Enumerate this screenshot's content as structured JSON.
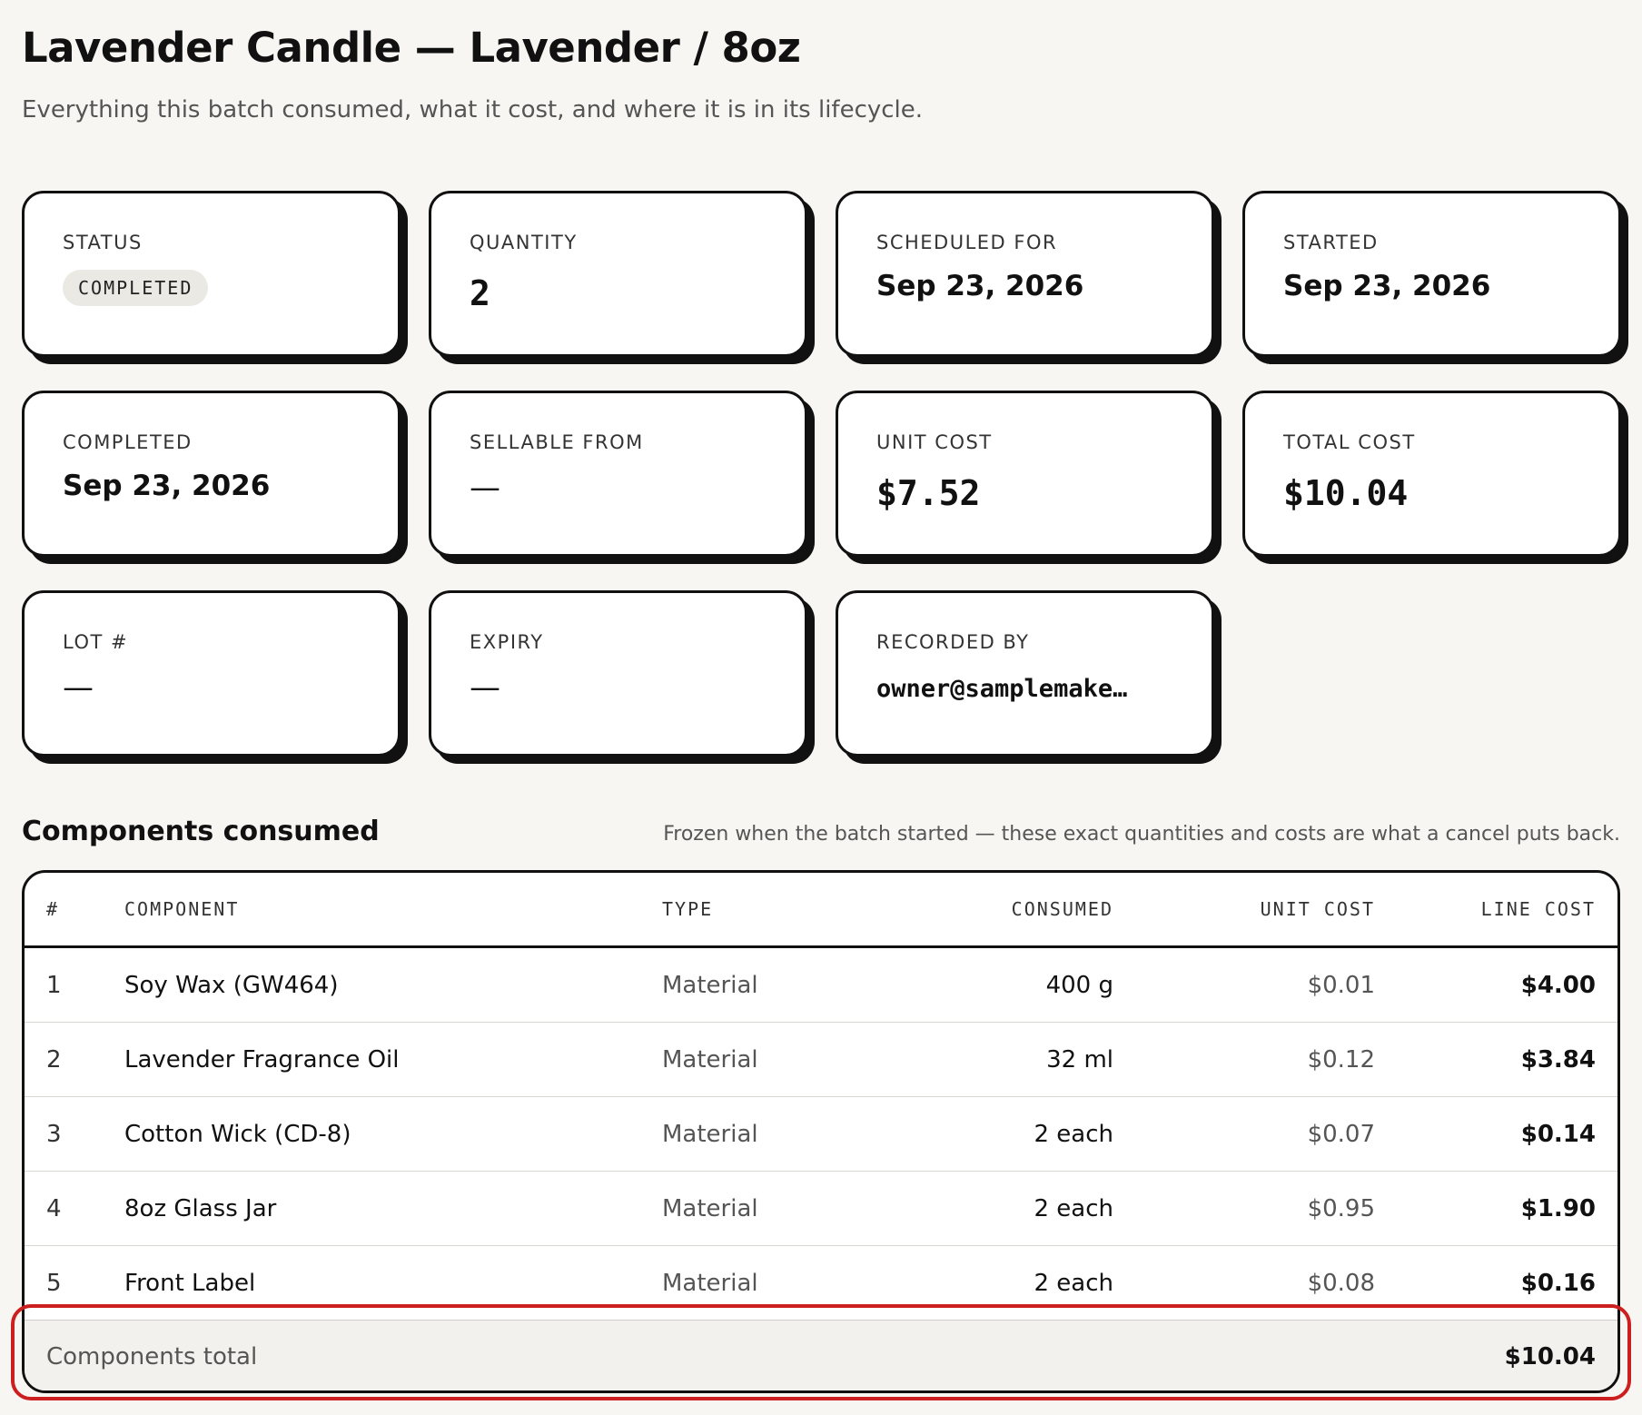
{
  "header": {
    "title": "Lavender Candle — Lavender / 8oz",
    "subtitle": "Everything this batch consumed, what it cost, and where it is in its lifecycle."
  },
  "stats": {
    "status": {
      "label": "STATUS",
      "value": "COMPLETED"
    },
    "quantity": {
      "label": "QUANTITY",
      "value": "2"
    },
    "scheduled_for": {
      "label": "SCHEDULED FOR",
      "value": "Sep 23, 2026"
    },
    "started": {
      "label": "STARTED",
      "value": "Sep 23, 2026"
    },
    "completed": {
      "label": "COMPLETED",
      "value": "Sep 23, 2026"
    },
    "sellable_from": {
      "label": "SELLABLE FROM",
      "value": "—"
    },
    "unit_cost": {
      "label": "UNIT COST",
      "value": "$7.52"
    },
    "total_cost": {
      "label": "TOTAL COST",
      "value": "$10.04"
    },
    "lot": {
      "label": "LOT #",
      "value": "—"
    },
    "expiry": {
      "label": "EXPIRY",
      "value": "—"
    },
    "recorded_by": {
      "label": "RECORDED BY",
      "value": "owner@samplemake…"
    }
  },
  "components": {
    "title": "Components consumed",
    "note": "Frozen when the batch started — these exact quantities and costs are what a cancel puts back.",
    "columns": {
      "num": "#",
      "component": "COMPONENT",
      "type": "TYPE",
      "consumed": "CONSUMED",
      "unit_cost": "UNIT COST",
      "line_cost": "LINE COST"
    },
    "rows": [
      {
        "num": "1",
        "component": "Soy Wax (GW464)",
        "type": "Material",
        "consumed": "400 g",
        "unit_cost": "$0.01",
        "line_cost": "$4.00"
      },
      {
        "num": "2",
        "component": "Lavender Fragrance Oil",
        "type": "Material",
        "consumed": "32 ml",
        "unit_cost": "$0.12",
        "line_cost": "$3.84"
      },
      {
        "num": "3",
        "component": "Cotton Wick (CD-8)",
        "type": "Material",
        "consumed": "2 each",
        "unit_cost": "$0.07",
        "line_cost": "$0.14"
      },
      {
        "num": "4",
        "component": "8oz Glass Jar",
        "type": "Material",
        "consumed": "2 each",
        "unit_cost": "$0.95",
        "line_cost": "$1.90"
      },
      {
        "num": "5",
        "component": "Front Label",
        "type": "Material",
        "consumed": "2 each",
        "unit_cost": "$0.08",
        "line_cost": "$0.16"
      }
    ],
    "total_label": "Components total",
    "total_value": "$10.04"
  },
  "colors": {
    "background": "#f7f6f3",
    "card_border": "#111111",
    "highlight": "#cc1f1f"
  }
}
